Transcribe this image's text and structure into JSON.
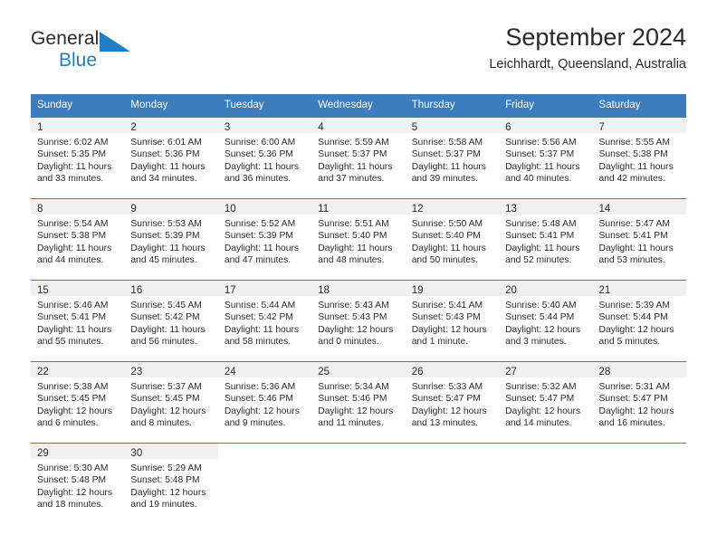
{
  "brand": {
    "name_part1": "General",
    "name_part2": "Blue",
    "triangle_icon": "triangle-icon",
    "accent_color": "#1f7ec4"
  },
  "header": {
    "title": "September 2024",
    "subtitle": "Leichhardt, Queensland, Australia"
  },
  "colors": {
    "header_blue": "#3b7dbf",
    "day_band_gray": "#f0f0f0",
    "text": "#2b2b2b"
  },
  "weekdays": [
    "Sunday",
    "Monday",
    "Tuesday",
    "Wednesday",
    "Thursday",
    "Friday",
    "Saturday"
  ],
  "weeks": [
    [
      {
        "day": "1",
        "sunrise": "Sunrise: 6:02 AM",
        "sunset": "Sunset: 5:35 PM",
        "daylight_line1": "Daylight: 11 hours",
        "daylight_line2": "and 33 minutes."
      },
      {
        "day": "2",
        "sunrise": "Sunrise: 6:01 AM",
        "sunset": "Sunset: 5:36 PM",
        "daylight_line1": "Daylight: 11 hours",
        "daylight_line2": "and 34 minutes."
      },
      {
        "day": "3",
        "sunrise": "Sunrise: 6:00 AM",
        "sunset": "Sunset: 5:36 PM",
        "daylight_line1": "Daylight: 11 hours",
        "daylight_line2": "and 36 minutes."
      },
      {
        "day": "4",
        "sunrise": "Sunrise: 5:59 AM",
        "sunset": "Sunset: 5:37 PM",
        "daylight_line1": "Daylight: 11 hours",
        "daylight_line2": "and 37 minutes."
      },
      {
        "day": "5",
        "sunrise": "Sunrise: 5:58 AM",
        "sunset": "Sunset: 5:37 PM",
        "daylight_line1": "Daylight: 11 hours",
        "daylight_line2": "and 39 minutes."
      },
      {
        "day": "6",
        "sunrise": "Sunrise: 5:56 AM",
        "sunset": "Sunset: 5:37 PM",
        "daylight_line1": "Daylight: 11 hours",
        "daylight_line2": "and 40 minutes."
      },
      {
        "day": "7",
        "sunrise": "Sunrise: 5:55 AM",
        "sunset": "Sunset: 5:38 PM",
        "daylight_line1": "Daylight: 11 hours",
        "daylight_line2": "and 42 minutes."
      }
    ],
    [
      {
        "day": "8",
        "sunrise": "Sunrise: 5:54 AM",
        "sunset": "Sunset: 5:38 PM",
        "daylight_line1": "Daylight: 11 hours",
        "daylight_line2": "and 44 minutes."
      },
      {
        "day": "9",
        "sunrise": "Sunrise: 5:53 AM",
        "sunset": "Sunset: 5:39 PM",
        "daylight_line1": "Daylight: 11 hours",
        "daylight_line2": "and 45 minutes."
      },
      {
        "day": "10",
        "sunrise": "Sunrise: 5:52 AM",
        "sunset": "Sunset: 5:39 PM",
        "daylight_line1": "Daylight: 11 hours",
        "daylight_line2": "and 47 minutes."
      },
      {
        "day": "11",
        "sunrise": "Sunrise: 5:51 AM",
        "sunset": "Sunset: 5:40 PM",
        "daylight_line1": "Daylight: 11 hours",
        "daylight_line2": "and 48 minutes."
      },
      {
        "day": "12",
        "sunrise": "Sunrise: 5:50 AM",
        "sunset": "Sunset: 5:40 PM",
        "daylight_line1": "Daylight: 11 hours",
        "daylight_line2": "and 50 minutes."
      },
      {
        "day": "13",
        "sunrise": "Sunrise: 5:48 AM",
        "sunset": "Sunset: 5:41 PM",
        "daylight_line1": "Daylight: 11 hours",
        "daylight_line2": "and 52 minutes."
      },
      {
        "day": "14",
        "sunrise": "Sunrise: 5:47 AM",
        "sunset": "Sunset: 5:41 PM",
        "daylight_line1": "Daylight: 11 hours",
        "daylight_line2": "and 53 minutes."
      }
    ],
    [
      {
        "day": "15",
        "sunrise": "Sunrise: 5:46 AM",
        "sunset": "Sunset: 5:41 PM",
        "daylight_line1": "Daylight: 11 hours",
        "daylight_line2": "and 55 minutes."
      },
      {
        "day": "16",
        "sunrise": "Sunrise: 5:45 AM",
        "sunset": "Sunset: 5:42 PM",
        "daylight_line1": "Daylight: 11 hours",
        "daylight_line2": "and 56 minutes."
      },
      {
        "day": "17",
        "sunrise": "Sunrise: 5:44 AM",
        "sunset": "Sunset: 5:42 PM",
        "daylight_line1": "Daylight: 11 hours",
        "daylight_line2": "and 58 minutes."
      },
      {
        "day": "18",
        "sunrise": "Sunrise: 5:43 AM",
        "sunset": "Sunset: 5:43 PM",
        "daylight_line1": "Daylight: 12 hours",
        "daylight_line2": "and 0 minutes."
      },
      {
        "day": "19",
        "sunrise": "Sunrise: 5:41 AM",
        "sunset": "Sunset: 5:43 PM",
        "daylight_line1": "Daylight: 12 hours",
        "daylight_line2": "and 1 minute."
      },
      {
        "day": "20",
        "sunrise": "Sunrise: 5:40 AM",
        "sunset": "Sunset: 5:44 PM",
        "daylight_line1": "Daylight: 12 hours",
        "daylight_line2": "and 3 minutes."
      },
      {
        "day": "21",
        "sunrise": "Sunrise: 5:39 AM",
        "sunset": "Sunset: 5:44 PM",
        "daylight_line1": "Daylight: 12 hours",
        "daylight_line2": "and 5 minutes."
      }
    ],
    [
      {
        "day": "22",
        "sunrise": "Sunrise: 5:38 AM",
        "sunset": "Sunset: 5:45 PM",
        "daylight_line1": "Daylight: 12 hours",
        "daylight_line2": "and 6 minutes."
      },
      {
        "day": "23",
        "sunrise": "Sunrise: 5:37 AM",
        "sunset": "Sunset: 5:45 PM",
        "daylight_line1": "Daylight: 12 hours",
        "daylight_line2": "and 8 minutes."
      },
      {
        "day": "24",
        "sunrise": "Sunrise: 5:36 AM",
        "sunset": "Sunset: 5:46 PM",
        "daylight_line1": "Daylight: 12 hours",
        "daylight_line2": "and 9 minutes."
      },
      {
        "day": "25",
        "sunrise": "Sunrise: 5:34 AM",
        "sunset": "Sunset: 5:46 PM",
        "daylight_line1": "Daylight: 12 hours",
        "daylight_line2": "and 11 minutes."
      },
      {
        "day": "26",
        "sunrise": "Sunrise: 5:33 AM",
        "sunset": "Sunset: 5:47 PM",
        "daylight_line1": "Daylight: 12 hours",
        "daylight_line2": "and 13 minutes."
      },
      {
        "day": "27",
        "sunrise": "Sunrise: 5:32 AM",
        "sunset": "Sunset: 5:47 PM",
        "daylight_line1": "Daylight: 12 hours",
        "daylight_line2": "and 14 minutes."
      },
      {
        "day": "28",
        "sunrise": "Sunrise: 5:31 AM",
        "sunset": "Sunset: 5:47 PM",
        "daylight_line1": "Daylight: 12 hours",
        "daylight_line2": "and 16 minutes."
      }
    ],
    [
      {
        "day": "29",
        "sunrise": "Sunrise: 5:30 AM",
        "sunset": "Sunset: 5:48 PM",
        "daylight_line1": "Daylight: 12 hours",
        "daylight_line2": "and 18 minutes."
      },
      {
        "day": "30",
        "sunrise": "Sunrise: 5:29 AM",
        "sunset": "Sunset: 5:48 PM",
        "daylight_line1": "Daylight: 12 hours",
        "daylight_line2": "and 19 minutes."
      },
      {
        "day": "",
        "sunrise": "",
        "sunset": "",
        "daylight_line1": "",
        "daylight_line2": ""
      },
      {
        "day": "",
        "sunrise": "",
        "sunset": "",
        "daylight_line1": "",
        "daylight_line2": ""
      },
      {
        "day": "",
        "sunrise": "",
        "sunset": "",
        "daylight_line1": "",
        "daylight_line2": ""
      },
      {
        "day": "",
        "sunrise": "",
        "sunset": "",
        "daylight_line1": "",
        "daylight_line2": ""
      },
      {
        "day": "",
        "sunrise": "",
        "sunset": "",
        "daylight_line1": "",
        "daylight_line2": ""
      }
    ]
  ]
}
